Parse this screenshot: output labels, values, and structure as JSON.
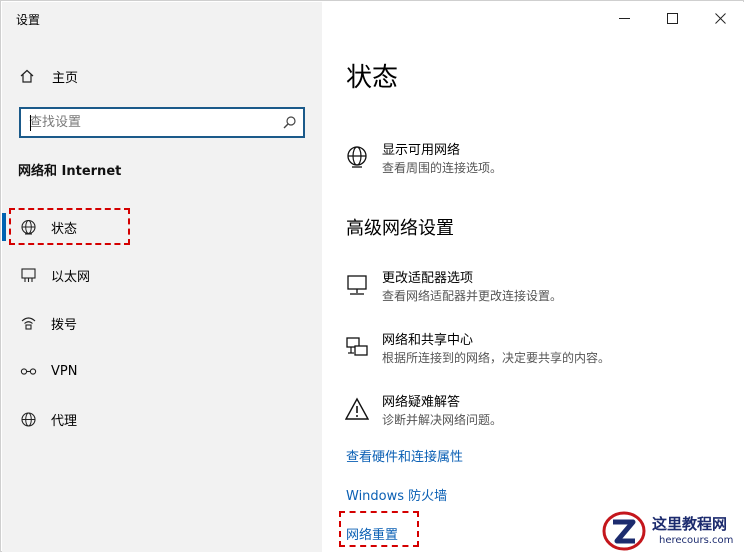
{
  "window": {
    "title": "设置"
  },
  "sidebar": {
    "home_label": "主页",
    "search_placeholder": "查找设置",
    "section_label": "网络和 Internet",
    "items": [
      {
        "label": "状态",
        "icon": "globe-icon",
        "active": true
      },
      {
        "label": "以太网",
        "icon": "ethernet-icon"
      },
      {
        "label": "拨号",
        "icon": "dialup-icon"
      },
      {
        "label": "VPN",
        "icon": "vpn-icon"
      },
      {
        "label": "代理",
        "icon": "proxy-globe-icon"
      }
    ]
  },
  "main": {
    "title": "状态",
    "show_networks": {
      "title": "显示可用网络",
      "desc": "查看周围的连接选项。"
    },
    "advanced_heading": "高级网络设置",
    "adapter": {
      "title": "更改适配器选项",
      "desc": "查看网络适配器并更改连接设置。"
    },
    "sharing": {
      "title": "网络和共享中心",
      "desc": "根据所连接到的网络，决定要共享的内容。"
    },
    "troubleshoot": {
      "title": "网络疑难解答",
      "desc": "诊断并解决网络问题。"
    },
    "links": {
      "hardware": "查看硬件和连接属性",
      "firewall": "Windows 防火墙",
      "reset": "网络重置"
    }
  },
  "watermark": {
    "name": "这里教程网",
    "url": "herecours.com"
  },
  "colors": {
    "accent": "#0063b1",
    "link": "#0a5fb4",
    "annotation": "#d40000"
  }
}
